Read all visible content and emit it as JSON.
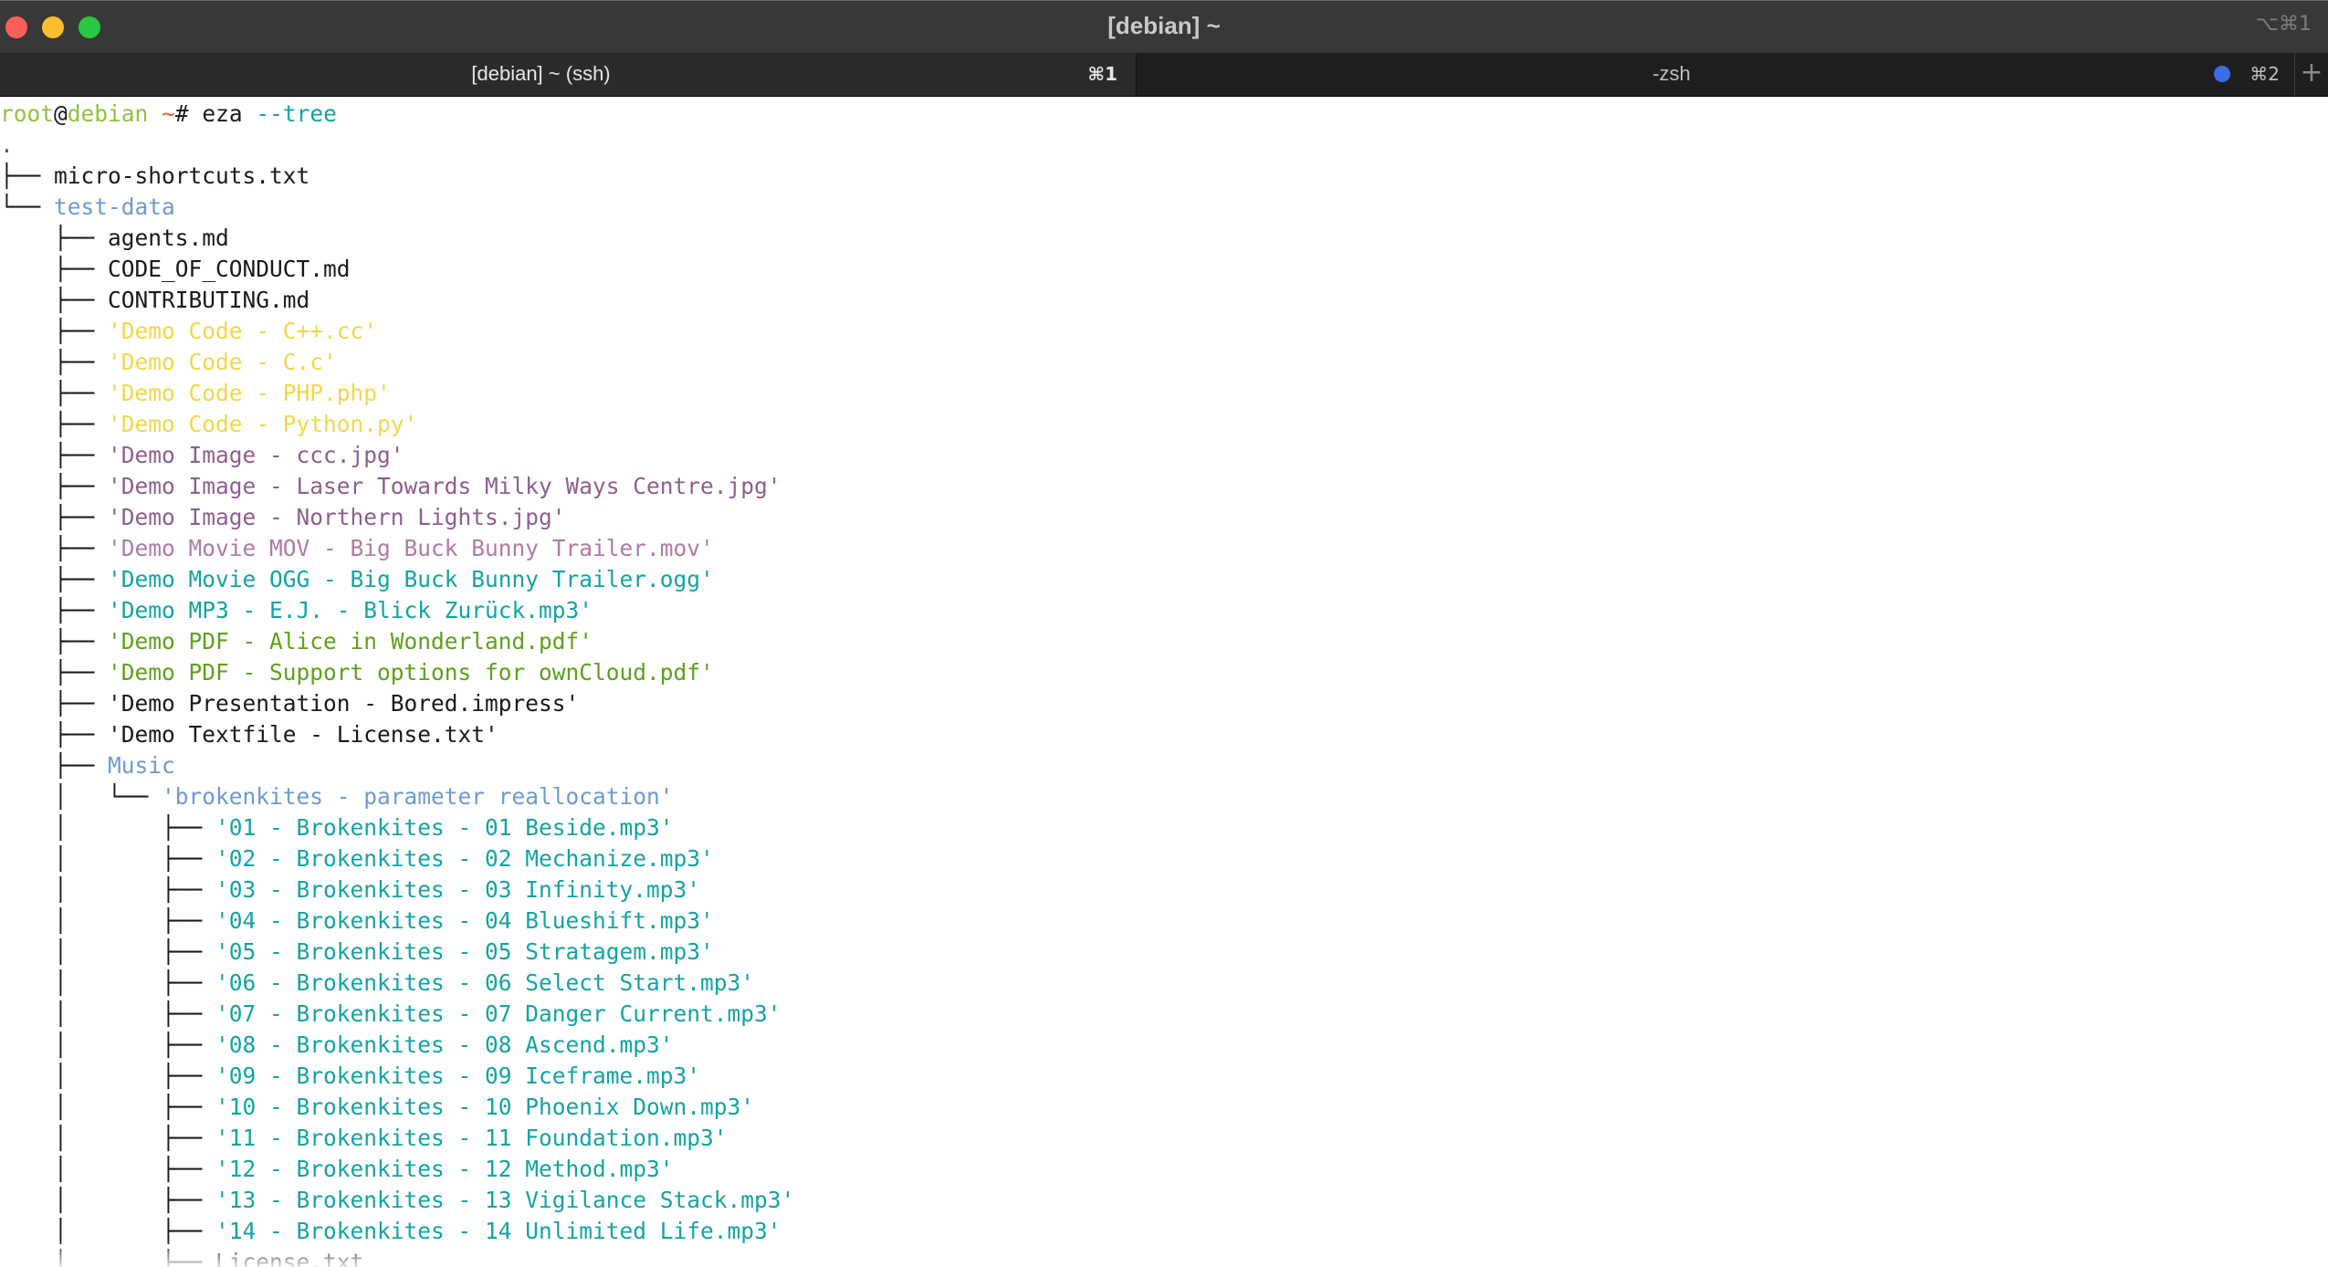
{
  "window": {
    "title": "[debian] ~",
    "shortcut": "⌥⌘1"
  },
  "tabs": [
    {
      "label": "[debian] ~ (ssh)",
      "shortcut": "⌘1",
      "active": true
    },
    {
      "label": "-zsh",
      "shortcut": "⌘2",
      "active": false,
      "indicator_color": "#3b6de6"
    }
  ],
  "new_tab_label": "+",
  "prompt": {
    "user": "root",
    "at": "@",
    "host": "debian",
    "path": " ~",
    "symbol": "# ",
    "command": "eza",
    "args": " --tree"
  },
  "colors": {
    "text": "#1a1a1a",
    "directory": "#6e9bcf",
    "code": "#f2d74a",
    "image": "#8f5e8f",
    "video": "#b07aa8",
    "audio": "#14a3a3",
    "document": "#5ea11c",
    "prompt_user": "#8fc440"
  },
  "tree": [
    {
      "prefix": ".",
      "name": "",
      "color": "gray"
    },
    {
      "prefix": "├── ",
      "name": "micro-shortcuts.txt",
      "color": "black"
    },
    {
      "prefix": "└── ",
      "name": "test-data",
      "color": "blue"
    },
    {
      "prefix": "    ├── ",
      "name": "agents.md",
      "color": "black"
    },
    {
      "prefix": "    ├── ",
      "name": "CODE_OF_CONDUCT.md",
      "color": "black"
    },
    {
      "prefix": "    ├── ",
      "name": "CONTRIBUTING.md",
      "color": "black"
    },
    {
      "prefix": "    ├── ",
      "name": "'Demo Code - C++.cc'",
      "color": "yellow"
    },
    {
      "prefix": "    ├── ",
      "name": "'Demo Code - C.c'",
      "color": "yellow"
    },
    {
      "prefix": "    ├── ",
      "name": "'Demo Code - PHP.php'",
      "color": "yellow"
    },
    {
      "prefix": "    ├── ",
      "name": "'Demo Code - Python.py'",
      "color": "yellow"
    },
    {
      "prefix": "    ├── ",
      "name": "'Demo Image - ccc.jpg'",
      "color": "purple"
    },
    {
      "prefix": "    ├── ",
      "name": "'Demo Image - Laser Towards Milky Ways Centre.jpg'",
      "color": "purple"
    },
    {
      "prefix": "    ├── ",
      "name": "'Demo Image - Northern Lights.jpg'",
      "color": "purple"
    },
    {
      "prefix": "    ├── ",
      "name": "'Demo Movie MOV - Big Buck Bunny Trailer.mov'",
      "color": "pink"
    },
    {
      "prefix": "    ├── ",
      "name": "'Demo Movie OGG - Big Buck Bunny Trailer.ogg'",
      "color": "teal"
    },
    {
      "prefix": "    ├── ",
      "name": "'Demo MP3 - E.J. - Blick Zurück.mp3'",
      "color": "teal"
    },
    {
      "prefix": "    ├── ",
      "name": "'Demo PDF - Alice in Wonderland.pdf'",
      "color": "green2"
    },
    {
      "prefix": "    ├── ",
      "name": "'Demo PDF - Support options for ownCloud.pdf'",
      "color": "green2"
    },
    {
      "prefix": "    ├── ",
      "name": "'Demo Presentation - Bored.impress'",
      "color": "black"
    },
    {
      "prefix": "    ├── ",
      "name": "'Demo Textfile - License.txt'",
      "color": "black"
    },
    {
      "prefix": "    ├── ",
      "name": "Music",
      "color": "blue"
    },
    {
      "prefix": "    │   └── ",
      "name": "'brokenkites - parameter reallocation'",
      "color": "blue"
    },
    {
      "prefix": "    │       ├── ",
      "name": "'01 - Brokenkites - 01 Beside.mp3'",
      "color": "teal"
    },
    {
      "prefix": "    │       ├── ",
      "name": "'02 - Brokenkites - 02 Mechanize.mp3'",
      "color": "teal"
    },
    {
      "prefix": "    │       ├── ",
      "name": "'03 - Brokenkites - 03 Infinity.mp3'",
      "color": "teal"
    },
    {
      "prefix": "    │       ├── ",
      "name": "'04 - Brokenkites - 04 Blueshift.mp3'",
      "color": "teal"
    },
    {
      "prefix": "    │       ├── ",
      "name": "'05 - Brokenkites - 05 Stratagem.mp3'",
      "color": "teal"
    },
    {
      "prefix": "    │       ├── ",
      "name": "'06 - Brokenkites - 06 Select Start.mp3'",
      "color": "teal"
    },
    {
      "prefix": "    │       ├── ",
      "name": "'07 - Brokenkites - 07 Danger Current.mp3'",
      "color": "teal"
    },
    {
      "prefix": "    │       ├── ",
      "name": "'08 - Brokenkites - 08 Ascend.mp3'",
      "color": "teal"
    },
    {
      "prefix": "    │       ├── ",
      "name": "'09 - Brokenkites - 09 Iceframe.mp3'",
      "color": "teal"
    },
    {
      "prefix": "    │       ├── ",
      "name": "'10 - Brokenkites - 10 Phoenix Down.mp3'",
      "color": "teal"
    },
    {
      "prefix": "    │       ├── ",
      "name": "'11 - Brokenkites - 11 Foundation.mp3'",
      "color": "teal"
    },
    {
      "prefix": "    │       ├── ",
      "name": "'12 - Brokenkites - 12 Method.mp3'",
      "color": "teal"
    },
    {
      "prefix": "    │       ├── ",
      "name": "'13 - Brokenkites - 13 Vigilance Stack.mp3'",
      "color": "teal"
    },
    {
      "prefix": "    │       ├── ",
      "name": "'14 - Brokenkites - 14 Unlimited Life.mp3'",
      "color": "teal"
    },
    {
      "prefix": "    │       ├── ",
      "name": "License.txt",
      "color": "black"
    }
  ]
}
